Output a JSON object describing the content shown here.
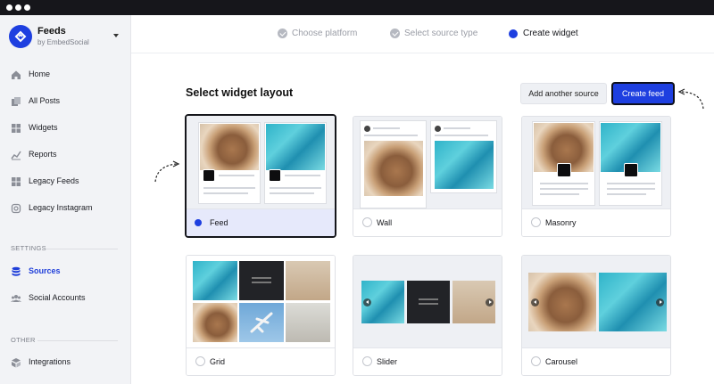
{
  "brand": {
    "title": "Feeds",
    "subtitle": "by EmbedSocial"
  },
  "sidebar": {
    "items": [
      {
        "label": "Home",
        "icon": "home-icon"
      },
      {
        "label": "All Posts",
        "icon": "posts-icon"
      },
      {
        "label": "Widgets",
        "icon": "widgets-icon"
      },
      {
        "label": "Reports",
        "icon": "reports-icon"
      },
      {
        "label": "Legacy Feeds",
        "icon": "legacy-feeds-icon"
      },
      {
        "label": "Legacy Instagram",
        "icon": "instagram-icon"
      }
    ],
    "settings_label": "SETTINGS",
    "settings_items": [
      {
        "label": "Sources",
        "icon": "sources-icon",
        "active": true
      },
      {
        "label": "Social Accounts",
        "icon": "users-icon"
      }
    ],
    "other_label": "OTHER",
    "other_items": [
      {
        "label": "Integrations",
        "icon": "integrations-icon"
      }
    ]
  },
  "steps": [
    {
      "label": "Choose platform",
      "state": "done"
    },
    {
      "label": "Select source type",
      "state": "done"
    },
    {
      "label": "Create widget",
      "state": "current"
    }
  ],
  "main": {
    "heading": "Select widget layout",
    "add_source_label": "Add another source",
    "create_feed_label": "Create feed"
  },
  "layouts": [
    {
      "label": "Feed",
      "selected": true
    },
    {
      "label": "Wall",
      "selected": false
    },
    {
      "label": "Masonry",
      "selected": false
    },
    {
      "label": "Grid",
      "selected": false
    },
    {
      "label": "Slider",
      "selected": false
    },
    {
      "label": "Carousel",
      "selected": false
    }
  ],
  "colors": {
    "accent": "#1e3fe0",
    "selected_footer": "#e6e9fb",
    "sidebar_bg": "#f2f3f6"
  }
}
